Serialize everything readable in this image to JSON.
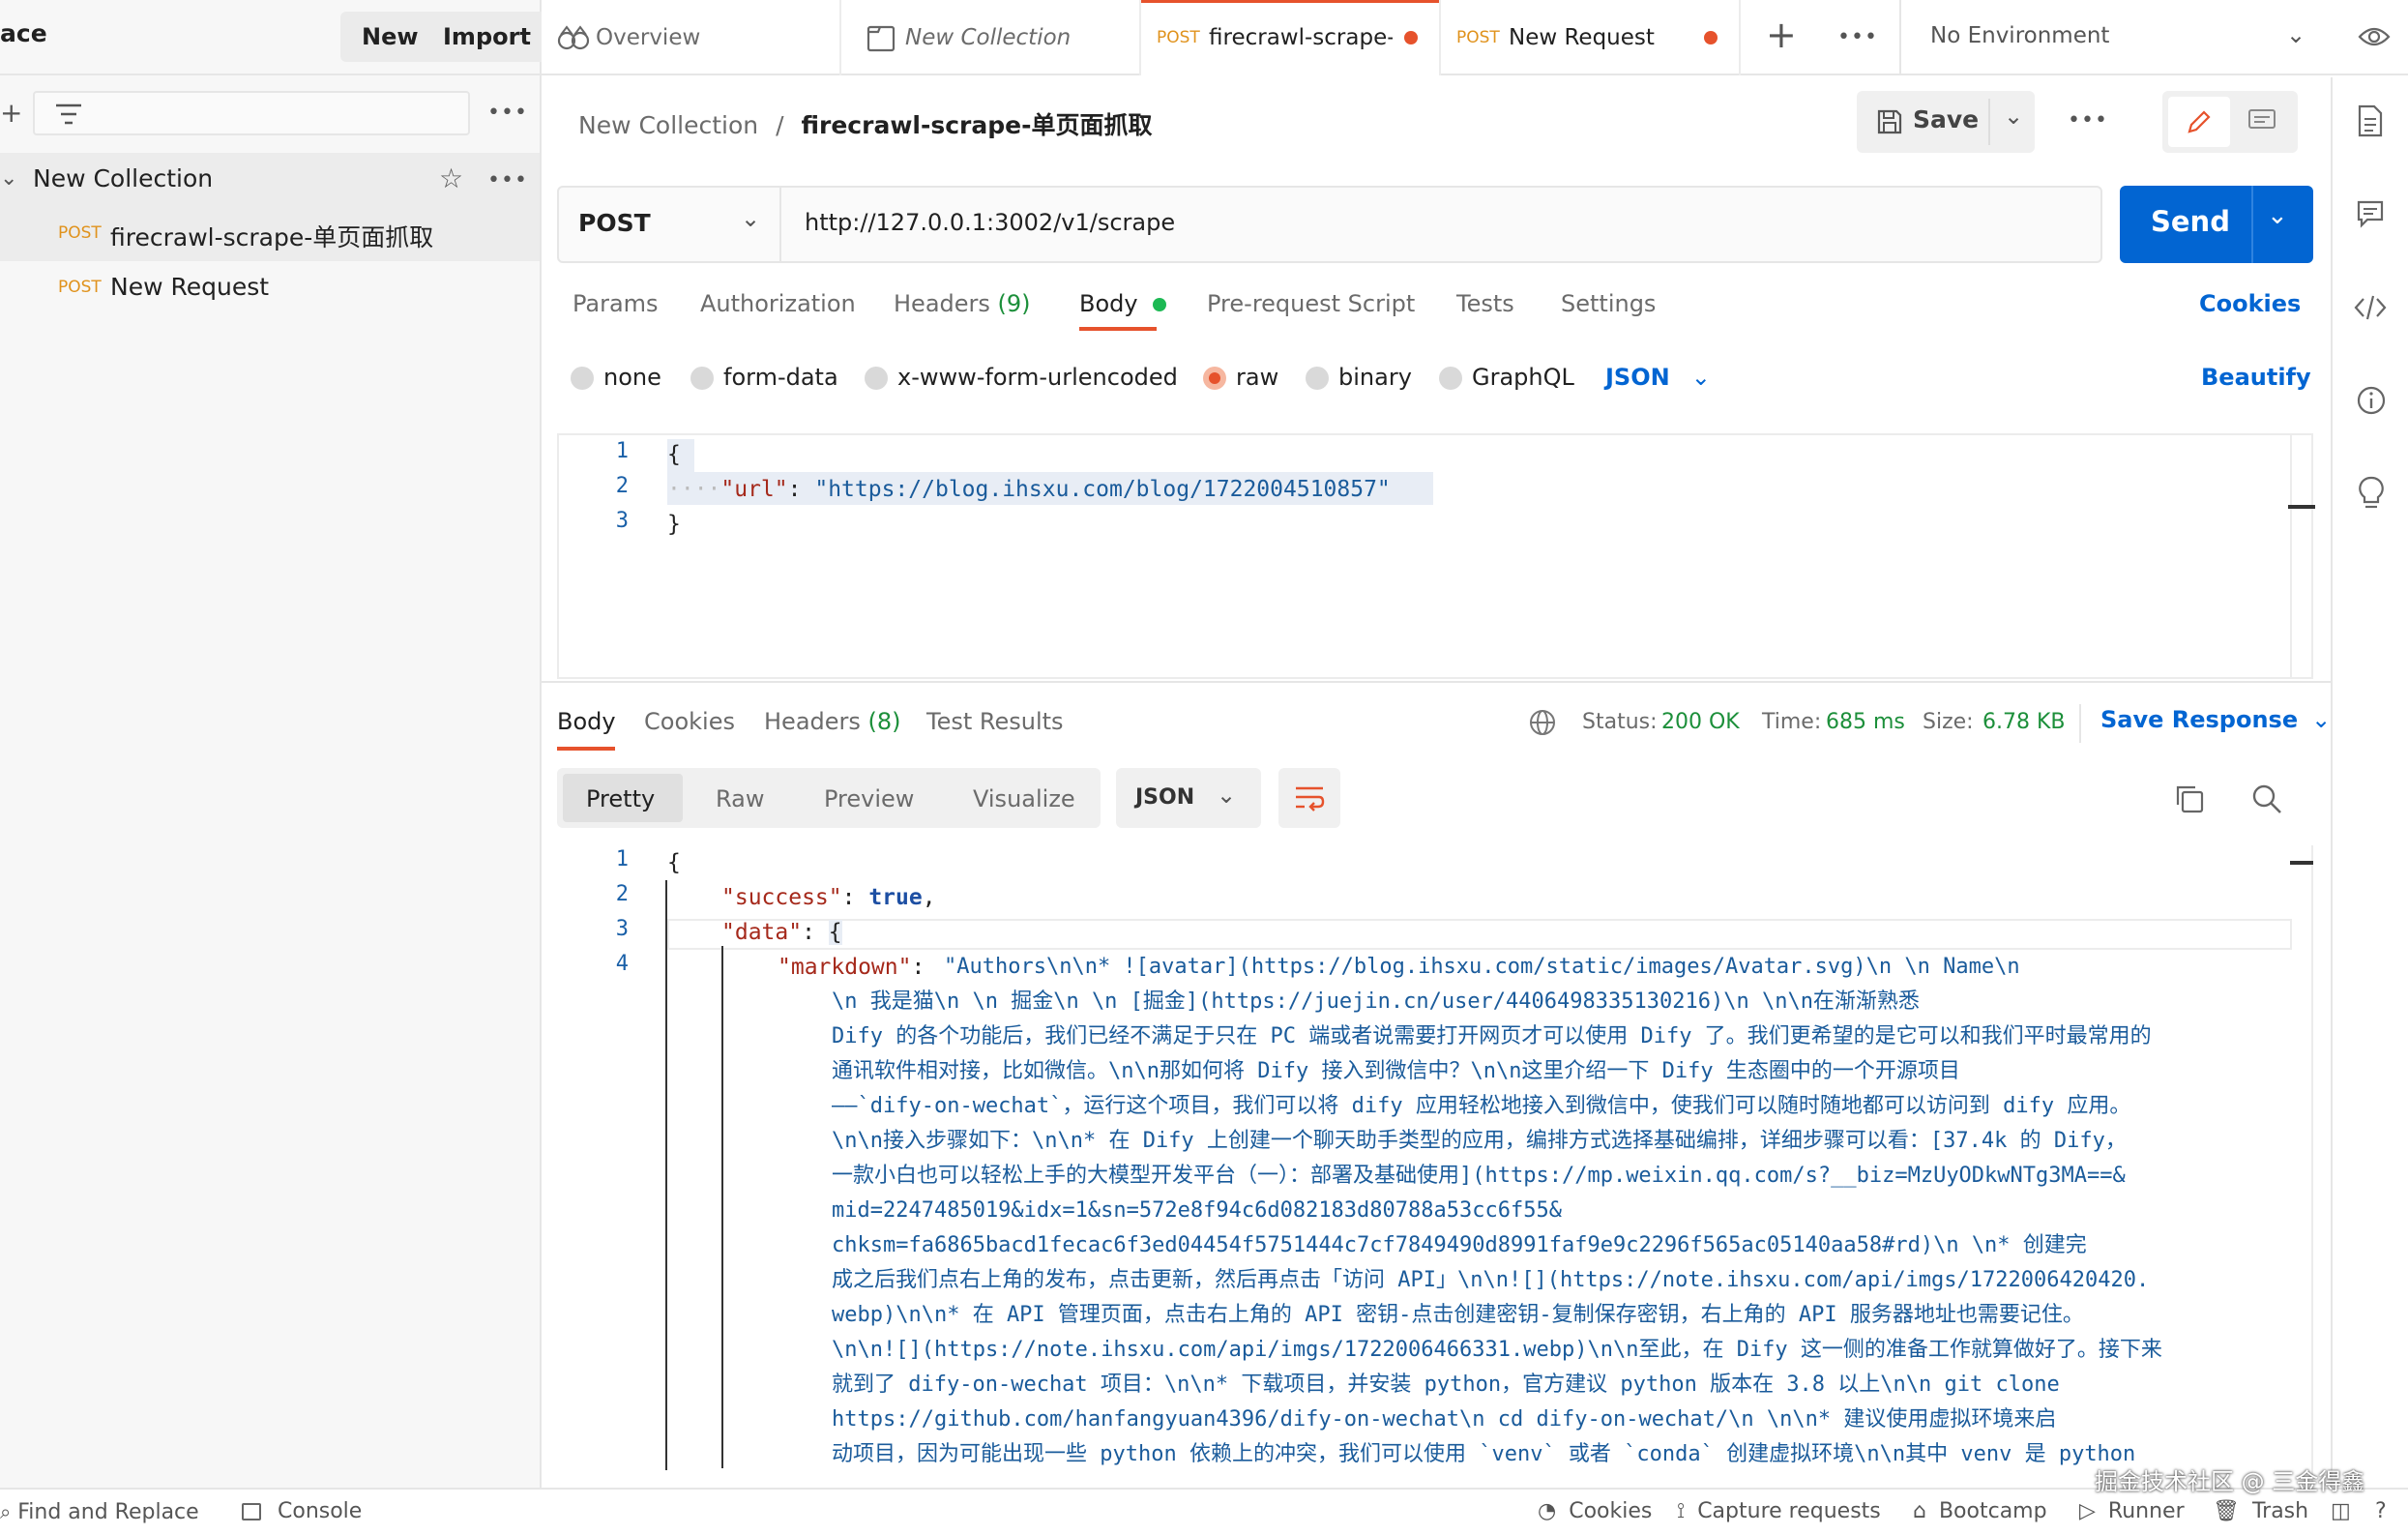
{
  "workspace": {
    "name_fragment": "ace",
    "new_label": "New",
    "import_label": "Import"
  },
  "sidebar": {
    "collection_name": "New Collection",
    "requests": [
      {
        "method": "POST",
        "name": "firecrawl-scrape-单页面抓取"
      },
      {
        "method": "POST",
        "name": "New Request"
      }
    ]
  },
  "tabs": [
    {
      "label": "Overview"
    },
    {
      "label": "New Collection"
    },
    {
      "method": "POST",
      "label": "firecrawl-scrape-单"
    },
    {
      "method": "POST",
      "label": "New Request"
    }
  ],
  "environment": "No Environment",
  "breadcrumb": {
    "parent": "New Collection",
    "sep": "/",
    "current": "firecrawl-scrape-单页面抓取"
  },
  "toolbar": {
    "save_label": "Save"
  },
  "request": {
    "method": "POST",
    "url": "http://127.0.0.1:3002/v1/scrape",
    "send_label": "Send",
    "tabs": {
      "params": "Params",
      "authorization": "Authorization",
      "headers": "Headers",
      "headers_count": "(9)",
      "body": "Body",
      "prerequest": "Pre-request Script",
      "tests": "Tests",
      "settings": "Settings"
    },
    "cookies_label": "Cookies",
    "body_modes": {
      "none": "none",
      "form_data": "form-data",
      "urlencoded": "x-www-form-urlencoded",
      "raw": "raw",
      "binary": "binary",
      "graphql": "GraphQL",
      "format": "JSON"
    },
    "beautify_label": "Beautify",
    "body_lines": [
      "{",
      "\"url\"",
      ": ",
      "\"https://blog.ihsxu.com/blog/1722004510857\"",
      "}"
    ]
  },
  "response": {
    "tabs": {
      "body": "Body",
      "cookies": "Cookies",
      "headers": "Headers",
      "headers_count": "(8)",
      "tests": "Test Results"
    },
    "status_label": "Status:",
    "status": "200 OK",
    "time_label": "Time:",
    "time": "685 ms",
    "size_label": "Size:",
    "size": "6.78 KB",
    "save_label": "Save Response",
    "views": {
      "pretty": "Pretty",
      "raw": "Raw",
      "preview": "Preview",
      "visualize": "Visualize",
      "format": "JSON"
    },
    "line_numbers": [
      "1",
      "2",
      "3",
      "4"
    ],
    "json": {
      "open": "{",
      "success_key": "\"success\"",
      "success_val": "true",
      "data_key": "\"data\"",
      "data_open": "{",
      "markdown_key": "\"markdown\"",
      "markdown_lines": [
        "\"Authors\\n\\n*   ![avatar](https://blog.ihsxu.com/static/images/Avatar.svg)\\n    \\n    Name\\n",
        "\\n    我是猫\\n    \\n    掘金\\n    \\n    [掘金](https://juejin.cn/user/4406498335130216)\\n    \\n\\n在渐渐熟悉",
        "Dify 的各个功能后，我们已经不满足于只在 PC 端或者说需要打开网页才可以使用 Dify 了。我们更希望的是它可以和我们平时最常用的",
        "通讯软件相对接，比如微信。\\n\\n那如何将 Dify 接入到微信中？\\n\\n这里介绍一下 Dify 生态圈中的一个开源项目",
        "——`dify-on-wechat`，运行这个项目，我们可以将 dify 应用轻松地接入到微信中，使我们可以随时随地都可以访问到 dify 应用。",
        "\\n\\n接入步骤如下：\\n\\n*   在 Dify 上创建一个聊天助手类型的应用，编排方式选择基础编排，详细步骤可以看：[37.4k 的 Dify，",
        "一款小白也可以轻松上手的大模型开发平台（一）：部署及基础使用](https://mp.weixin.qq.com/s?__biz=MzUyODkwNTg3MA==&",
        "mid=2247485019&idx=1&sn=572e8f94c6d082183d80788a53cc6f55&",
        "chksm=fa6865bacd1fecac6f3ed04454f5751444c7cf7849490d8991faf9e9c2296f565ac05140aa58#rd)\\n    \\n*   创建完",
        "成之后我们点右上角的发布，点击更新，然后再点击「访问 API」\\n\\n![](https://note.ihsxu.com/api/imgs/1722006420420.",
        "webp)\\n\\n*   在 API 管理页面，点击右上角的 API 密钥-点击创建密钥-复制保存密钥，右上角的 API 服务器地址也需要记住。",
        "\\n\\n![](https://note.ihsxu.com/api/imgs/1722006466331.webp)\\n\\n至此，在 Dify 这一侧的准备工作就算做好了。接下来",
        "就到了 dify-on-wechat 项目：\\n\\n*   下载项目，并安装 python，官方建议 python 版本在 3.8 以上\\n\\n    git clone",
        "https://github.com/hanfangyuan4396/dify-on-wechat\\n    cd dify-on-wechat/\\n    \\n\\n*   建议使用虚拟环境来启",
        "动项目，因为可能出现一些 python 依赖上的冲突，我们可以使用 `venv` 或者 `conda` 创建虚拟环境\\n\\n其中 venv 是 python"
      ]
    }
  },
  "statusbar": {
    "find_replace": "Find and Replace",
    "console": "Console",
    "cookies": "Cookies",
    "capture": "Capture requests",
    "bootcamp": "Bootcamp",
    "runner": "Runner",
    "trash": "Trash",
    "watermark": "掘金技术社区 @ 三金得鑫"
  }
}
